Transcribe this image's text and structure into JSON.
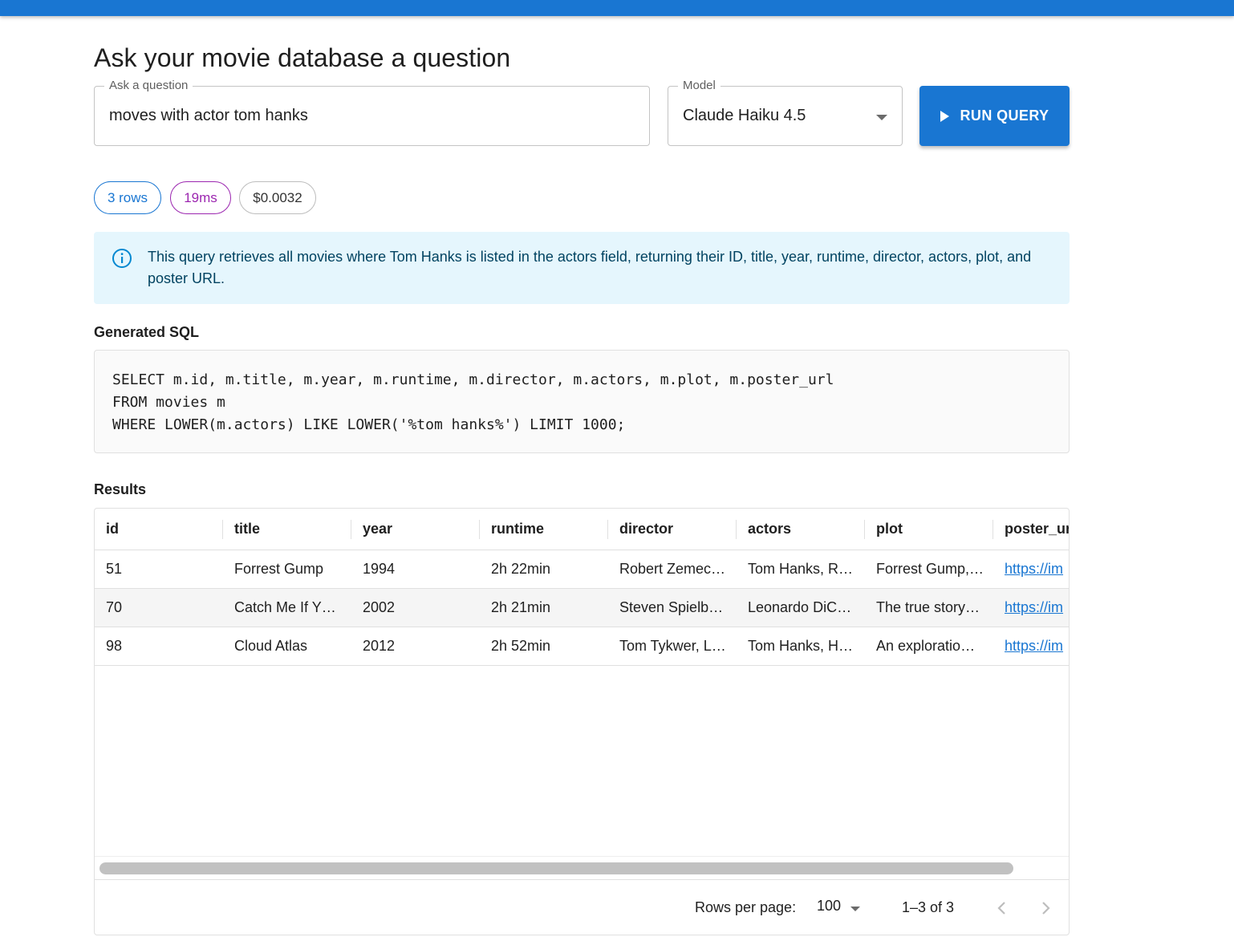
{
  "page": {
    "title": "Ask your movie database a question"
  },
  "question": {
    "label": "Ask a question",
    "value": "moves with actor tom hanks"
  },
  "model": {
    "label": "Model",
    "value": "Claude Haiku 4.5"
  },
  "run_button": {
    "label": "RUN QUERY",
    "icon": "play-icon"
  },
  "chips": {
    "rows": "3 rows",
    "time": "19ms",
    "cost": "$0.0032"
  },
  "info": {
    "icon": "info-icon",
    "text": "This query retrieves all movies where Tom Hanks is listed in the actors field, returning their ID, title, year, runtime, director, actors, plot, and poster URL."
  },
  "sql": {
    "label": "Generated SQL",
    "lines": [
      "SELECT m.id, m.title, m.year, m.runtime, m.director, m.actors, m.plot, m.poster_url",
      "FROM movies m",
      "WHERE LOWER(m.actors) LIKE LOWER('%tom hanks%') LIMIT 1000;"
    ]
  },
  "results": {
    "label": "Results",
    "columns": [
      "id",
      "title",
      "year",
      "runtime",
      "director",
      "actors",
      "plot",
      "poster_ur"
    ],
    "rows": [
      [
        "51",
        "Forrest Gump",
        "1994",
        "2h 22min",
        "Robert Zemec…",
        "Tom Hanks, R…",
        "Forrest Gump,…",
        "https://im"
      ],
      [
        "70",
        "Catch Me If Y…",
        "2002",
        "2h 21min",
        "Steven Spielb…",
        "Leonardo DiC…",
        "The true story…",
        "https://im"
      ],
      [
        "98",
        "Cloud Atlas",
        "2012",
        "2h 52min",
        "Tom Tykwer, L…",
        "Tom Hanks, H…",
        "An exploratio…",
        "https://im"
      ]
    ],
    "footer": {
      "rows_per_page_label": "Rows per page:",
      "rows_per_page_value": "100",
      "page_info": "1–3 of 3"
    }
  },
  "colors": {
    "primary": "#1976d2",
    "secondary": "#9c27b0",
    "info_bg": "#e5f6fd",
    "info_text": "#014361"
  }
}
